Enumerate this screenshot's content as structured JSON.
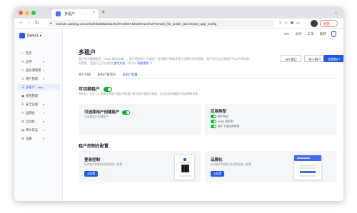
{
  "browser": {
    "tab_title": "多租户",
    "url": "console.authing.cn/console/62b5bb46100cf72c00374d33/tenant/v2/?tenant_list_active_tab=tenant_app_config",
    "update_label": "更新 ⋮",
    "colors": {
      "tabbar_bg": "#dfe3e8",
      "close": "#fe5f57",
      "minimize": "#febc2e",
      "maximize": "#28c840"
    }
  },
  "sidebar": {
    "brand": "Demo1 ▾",
    "items": [
      {
        "icon": "⌂",
        "label": "首页"
      },
      {
        "icon": "☷",
        "label": "应用",
        "caret": "▾"
      },
      {
        "icon": "⚇",
        "label": "身份源管理",
        "caret": "▾"
      },
      {
        "icon": "♙",
        "label": "用户管理",
        "caret": "▾"
      },
      {
        "icon": "☰",
        "label": "多租户",
        "badge": "beta",
        "active": true
      },
      {
        "icon": "▣",
        "label": "权限管理"
      },
      {
        "icon": "⛨",
        "label": "安全设置",
        "caret": "▾"
      },
      {
        "icon": "✎",
        "label": "品牌化",
        "caret": "▾"
      },
      {
        "icon": "⚙",
        "label": "自动化",
        "caret": "▾"
      },
      {
        "icon": "▤",
        "label": "审计日志",
        "caret": "▾"
      },
      {
        "icon": "⚙",
        "label": "设置",
        "caret": "▾"
      }
    ]
  },
  "topbar": {
    "api": "API",
    "docs": "文档",
    "ticket": "工单",
    "recommend": "推荐"
  },
  "header": {
    "title": "多租户",
    "description": "租户作为管理账号（SaaS 服务实体），用于把你的一个或多个应用账户隔离并进行品牌与访问控制。用户也可以在多租户中以不同的身份登录，至此可让",
    "description_more": "不仅复用",
    "link_doc": "使用文档",
    "description_tail": "，你可以",
    "link_video": "观看视频 ↗",
    "btn_api": "API 接口",
    "btn_import": "导入租户",
    "btn_create": "创建租户"
  },
  "tabs": [
    {
      "label": "租户列表"
    },
    {
      "label": "多租户管理员"
    },
    {
      "label": "多租户配置",
      "active": true
    }
  ],
  "switch_section": {
    "title": "可切换租户",
    "enabled": true,
    "description": "开启后，允许个人登录过的用户通过不同租户账号进行登录与体验，也可在其所属租户间选择和切换"
  },
  "card_user_create": {
    "title": "可选择用户创建租户",
    "enabled": true,
    "subtitle": "可选择用户创建租户"
  },
  "card_app_type": {
    "title": "应用类型",
    "options": [
      {
        "label": "租户独占",
        "enabled": true
      },
      {
        "label": "SaaS 型应用",
        "enabled": true
      },
      {
        "label": "租户下单应用类型",
        "enabled": true
      }
    ]
  },
  "console_section": {
    "title": "租户控制台配置"
  },
  "card_login": {
    "title": "登录控制",
    "subtitle": "针对租户控制台的登录统一配置",
    "button": "去配置"
  },
  "card_branding": {
    "title": "品牌化",
    "subtitle": "针对租户控制台的品牌化统一配置",
    "button": "去配置"
  }
}
